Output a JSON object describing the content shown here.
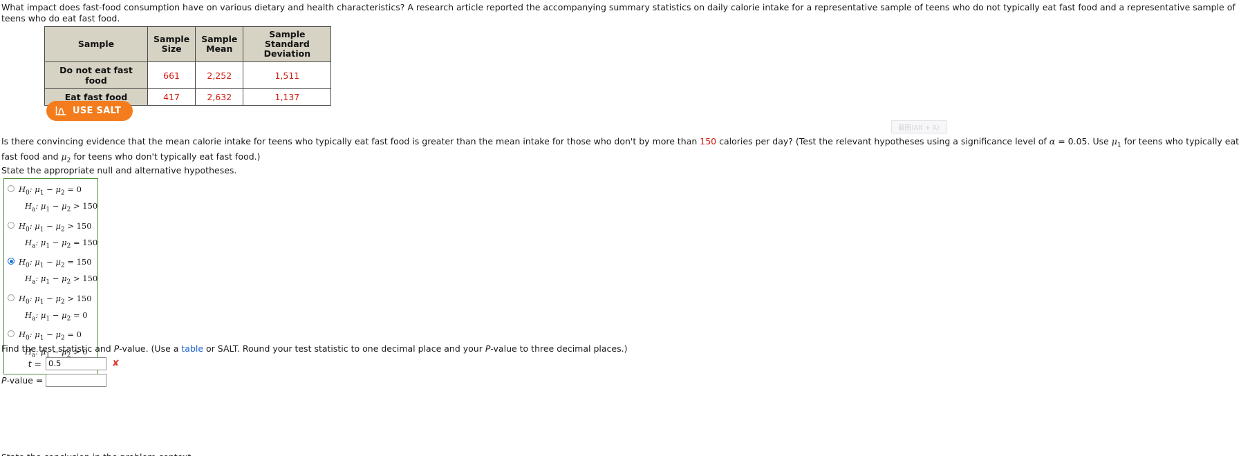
{
  "intro": {
    "text": "What impact does fast-food consumption have on various dietary and health characteristics? A research article reported the accompanying summary statistics on daily calorie intake for a representative sample of teens who do not typically eat fast food and a representative sample of teens who do eat fast food."
  },
  "table": {
    "headers": [
      "Sample",
      "Sample Size",
      "Sample Mean",
      "Sample Standard Deviation"
    ],
    "header_lines": [
      [
        "Sample"
      ],
      [
        "Sample",
        "Size"
      ],
      [
        "Sample",
        "Mean"
      ],
      [
        "Sample Standard",
        "Deviation"
      ]
    ],
    "rows": [
      {
        "sample": "Do not eat fast food",
        "size": "661",
        "mean": "2,252",
        "sd": "1,511"
      },
      {
        "sample": "Eat fast food",
        "size": "417",
        "mean": "2,632",
        "sd": "1,137"
      }
    ],
    "header_bg": "#d6d2c4",
    "value_color": "#d11a10"
  },
  "salt_button": {
    "label": "USE SALT",
    "icon": "distribution-curve-icon",
    "color": "#f47c1c"
  },
  "snip_widget": {
    "label": "截图(Alt + A)"
  },
  "question": {
    "part1": "Is there convincing evidence that the mean calorie intake for teens who typically eat fast food is greater than the mean intake for those who don't by more than ",
    "highlight": "150",
    "part2": " calories per day? (Test the relevant hypotheses using a significance level of ",
    "alpha": "α",
    "part3": " = 0.05. Use ",
    "mu1": "μ",
    "mu1sub": "1",
    "part4": " for teens who typically eat fast food and ",
    "mu2": "μ",
    "mu2sub": "2",
    "part5": " for teens who don't typically eat fast food.)"
  },
  "state_prompt": "State the appropriate null and alternative hypotheses.",
  "hypotheses": {
    "options": [
      {
        "null": {
          "h": "H",
          "sub": "0",
          "body": ": μ",
          "s1": "1",
          "minus": " − μ",
          "s2": "2",
          "rel": " = 0"
        },
        "alt": {
          "h": "H",
          "sub": "a",
          "body": ": μ",
          "s1": "1",
          "minus": " − μ",
          "s2": "2",
          "rel": " > 150"
        },
        "selected": false
      },
      {
        "null": {
          "h": "H",
          "sub": "0",
          "body": ": μ",
          "s1": "1",
          "minus": " − μ",
          "s2": "2",
          "rel": " > 150"
        },
        "alt": {
          "h": "H",
          "sub": "a",
          "body": ": μ",
          "s1": "1",
          "minus": " − μ",
          "s2": "2",
          "rel": " = 150"
        },
        "selected": false
      },
      {
        "null": {
          "h": "H",
          "sub": "0",
          "body": ": μ",
          "s1": "1",
          "minus": " − μ",
          "s2": "2",
          "rel": " = 150"
        },
        "alt": {
          "h": "H",
          "sub": "a",
          "body": ": μ",
          "s1": "1",
          "minus": " − μ",
          "s2": "2",
          "rel": " > 150"
        },
        "selected": true
      },
      {
        "null": {
          "h": "H",
          "sub": "0",
          "body": ": μ",
          "s1": "1",
          "minus": " − μ",
          "s2": "2",
          "rel": " > 150"
        },
        "alt": {
          "h": "H",
          "sub": "a",
          "body": ": μ",
          "s1": "1",
          "minus": " − μ",
          "s2": "2",
          "rel": " = 0"
        },
        "selected": false
      },
      {
        "null": {
          "h": "H",
          "sub": "0",
          "body": ": μ",
          "s1": "1",
          "minus": " − μ",
          "s2": "2",
          "rel": " = 0"
        },
        "alt": {
          "h": "H",
          "sub": "a",
          "body": ": μ",
          "s1": "1",
          "minus": " − μ",
          "s2": "2",
          "rel": " > 0"
        },
        "selected": false
      }
    ],
    "correct_mark": "✔",
    "correct_mark_color": "#5aa84a",
    "border_color": "#4a8b34"
  },
  "find_line": {
    "part1": "Find the test statistic and ",
    "pital1": "P",
    "part2": "-value. (Use a ",
    "link": "table",
    "part3": " or SALT. Round your test statistic to one decimal place and your ",
    "pital2": "P",
    "part4": "-value to three decimal places.)"
  },
  "answers": {
    "t": {
      "label_italic": "t",
      "label_eq": " =",
      "value": "0.5",
      "mark": "✘",
      "mark_color": "#e03b30"
    },
    "pvalue": {
      "label_italic": "P",
      "label_rest": "-value  =",
      "value": ""
    }
  },
  "cut_line": "State the conclusion in the problem context."
}
